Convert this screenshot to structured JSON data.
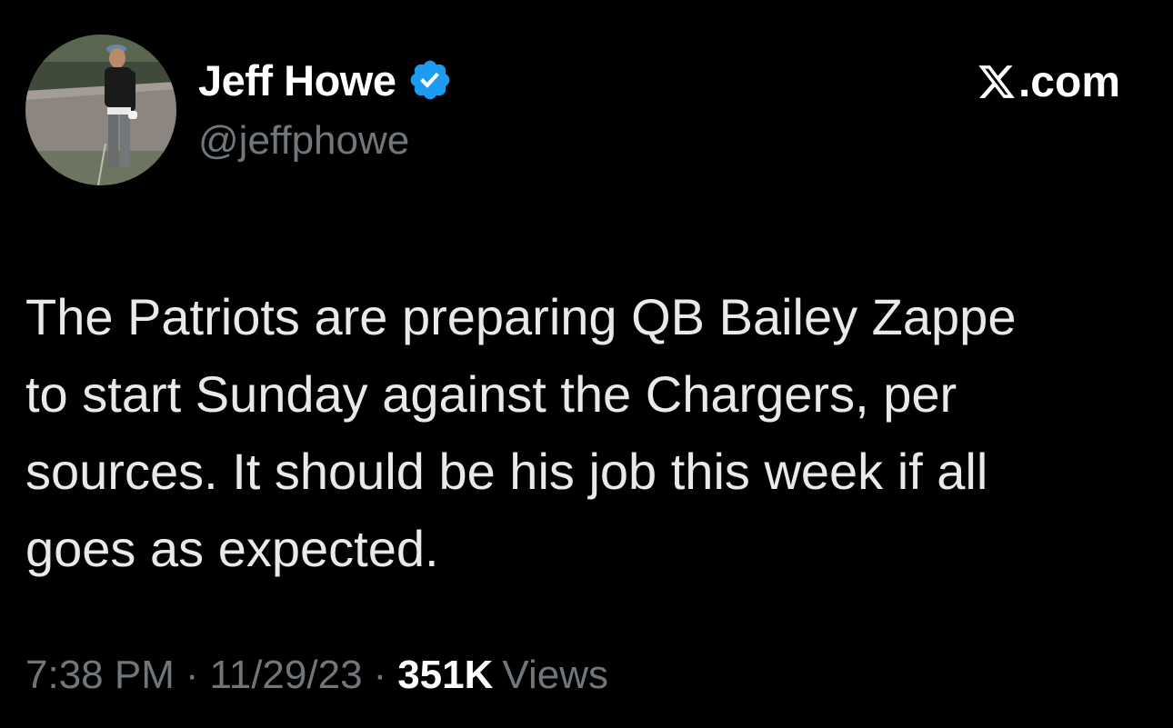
{
  "author": {
    "display_name": "Jeff Howe",
    "handle": "@jeffphowe",
    "verified": true,
    "avatar_icon": "golfer-avatar",
    "badge_color": "#1d9bf0"
  },
  "brand": {
    "icon": "x-logo-icon",
    "text": ".com"
  },
  "tweet": {
    "text": "The Patriots are preparing QB Bailey Zappe\nto start Sunday against the Chargers, per\nsources. It should be his job this week if all\ngoes as expected."
  },
  "meta": {
    "time": "7:38 PM",
    "separator": "·",
    "date": "11/29/23",
    "views_count": "351K",
    "views_label": "Views"
  }
}
